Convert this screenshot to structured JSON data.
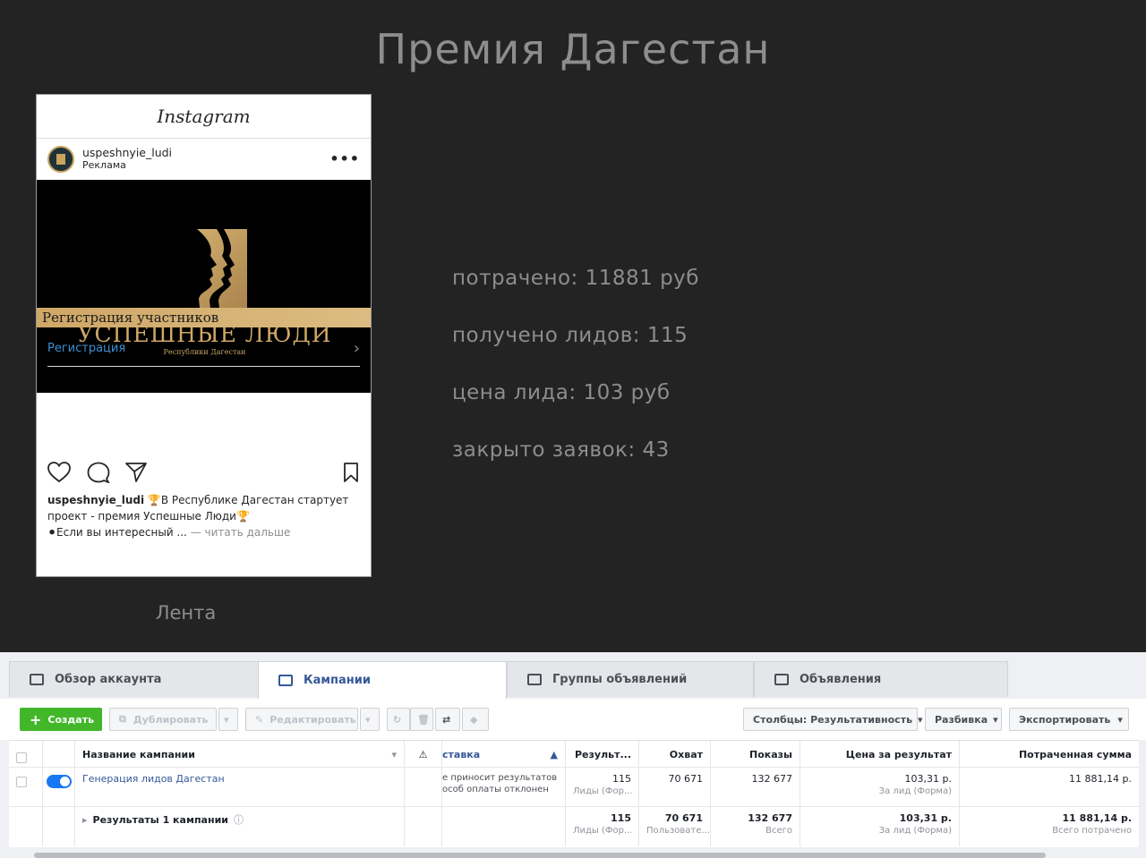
{
  "slide": {
    "title": "Премия Дагестан",
    "feed_label": "Лента",
    "stats": [
      "потрачено: 11881 руб",
      "получено лидов: 115",
      "цена лида: 103 руб",
      "закрыто заявок: 43"
    ]
  },
  "instagram": {
    "logo": "Instagram",
    "username": "uspeshnyie_ludi",
    "sponsored": "Реклама",
    "brand_title": "УСПЕШНЫЕ ЛЮДИ",
    "brand_subtitle": "Республики Дагестан",
    "strip_text": "Регистрация участников",
    "cta_label": "Регистрация",
    "caption_user": "uspeshnyie_ludi",
    "caption_line1": "🏆В Республике Дагестан стартует",
    "caption_line2": "проект - премия Успешные Люди🏆",
    "caption_line3": "⚫Если вы интересный ...",
    "caption_more": " — читать дальше",
    "colors": {
      "gold": "#d0a867",
      "link": "#3f8fd6"
    }
  },
  "ads_manager": {
    "tabs": [
      "Обзор аккаунта",
      "Кампании",
      "Группы объявлений",
      "Объявления"
    ],
    "active_tab": "Кампании",
    "toolbar": {
      "create": "Создать",
      "duplicate": "Дублировать",
      "edit": "Редактировать",
      "columns": "Столбцы: Результативность",
      "breakdown": "Разбивка",
      "export": "Экспортировать"
    },
    "columns": [
      "Название кампании",
      "ставка",
      "Результ...",
      "Охват",
      "Показы",
      "Цена за результат",
      "Потраченная сумма"
    ],
    "rows": [
      {
        "name": "Генерация лидов Дагестан",
        "bid_line1": "е приносит результатов",
        "bid_line2": "особ оплаты отклонен",
        "results": "115",
        "results_sub": "Лиды (Фор...",
        "reach": "70 671",
        "impressions": "132 677",
        "cost": "103,31 р.",
        "cost_sub": "За лид (Форма)",
        "spent": "11 881,14 р."
      }
    ],
    "total": {
      "name": "Результаты 1 кампании",
      "results": "115",
      "results_sub": "Лиды (Фор...",
      "reach": "70 671",
      "reach_sub": "Пользовате...",
      "impressions": "132 677",
      "impressions_sub": "Всего",
      "cost": "103,31 р.",
      "cost_sub": "За лид (Форма)",
      "spent": "11 881,14 р.",
      "spent_sub": "Всего потрачено"
    }
  }
}
